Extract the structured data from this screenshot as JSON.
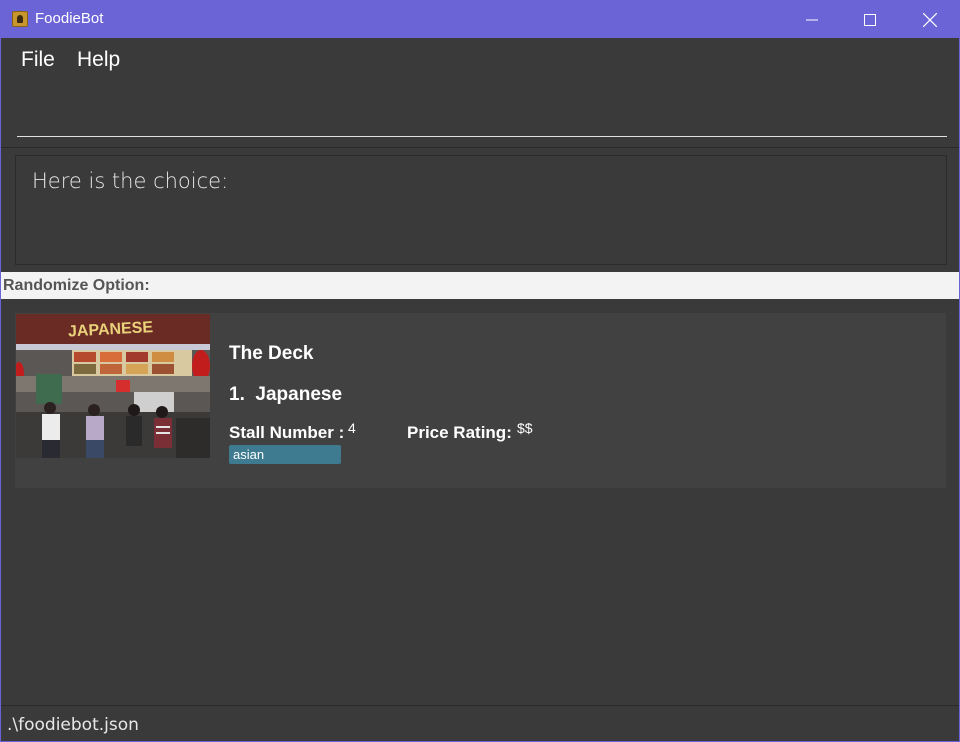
{
  "window": {
    "title": "FoodieBot",
    "controls": [
      "minimize",
      "maximize",
      "close"
    ]
  },
  "menu": {
    "items": [
      {
        "label": "File"
      },
      {
        "label": "Help"
      }
    ]
  },
  "command": {
    "value": "",
    "placeholder": ""
  },
  "result": {
    "text": "Here is the choice:"
  },
  "randomize": {
    "header": "Randomize Option:"
  },
  "card": {
    "name": "The Deck",
    "cuisine": "1.  Japanese",
    "image_sign_text": "JAPANESE",
    "stall_label": "Stall Number :",
    "stall_value": "4",
    "price_label": "Price Rating:",
    "price_value": "$$",
    "tags": [
      "asian"
    ]
  },
  "status": {
    "path": ".\\foodiebot.json"
  },
  "colors": {
    "titlebar": "#6b64d6",
    "background": "#3a3a3a",
    "card": "#414141",
    "tag": "#3e7b91",
    "header_strip": "#f3f3f3"
  }
}
